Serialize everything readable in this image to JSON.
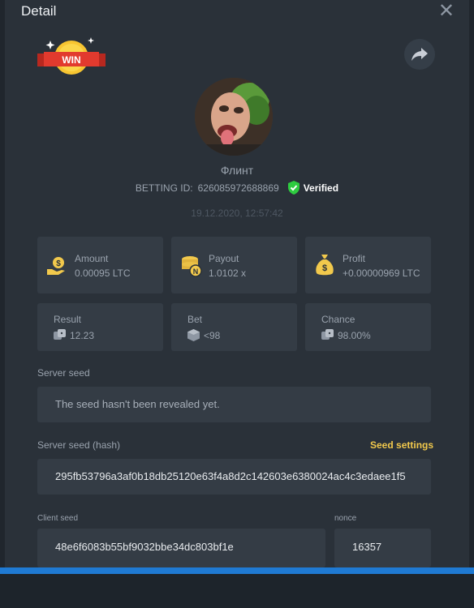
{
  "modal": {
    "title": "Detail",
    "close_icon": "close-icon"
  },
  "badge": {
    "text": "WIN"
  },
  "player": {
    "name": "Флинт",
    "betting_id_label": "BETTING ID:",
    "betting_id": "626085972688869",
    "verified_label": "Verified",
    "timestamp": "19.12.2020, 12:57:42"
  },
  "stats": {
    "amount": {
      "label": "Amount",
      "value": "0.00095 LTC"
    },
    "payout": {
      "label": "Payout",
      "value": "1.0102 x"
    },
    "profit": {
      "label": "Profit",
      "value": "+0.00000969 LTC"
    },
    "result": {
      "label": "Result",
      "value": "12.23"
    },
    "bet": {
      "label": "Bet",
      "value": "<98"
    },
    "chance": {
      "label": "Chance",
      "value": "98.00%"
    }
  },
  "server_seed": {
    "label": "Server seed",
    "value": "The seed hasn't been revealed yet."
  },
  "server_seed_hash": {
    "label": "Server seed (hash)",
    "settings_link": "Seed settings",
    "value": "295fb53796a3af0b18db25120e63f4a8d2c142603e6380024ac4c3edaee1f5"
  },
  "client_seed": {
    "label": "Client seed",
    "value": "48e6f6083b55bf9032bbe34dc803bf1e"
  },
  "nonce": {
    "label": "nonce",
    "value": "16357"
  },
  "colors": {
    "accent": "#f2c94c",
    "verified": "#2ecc40",
    "bar": "#1f7ad3"
  }
}
